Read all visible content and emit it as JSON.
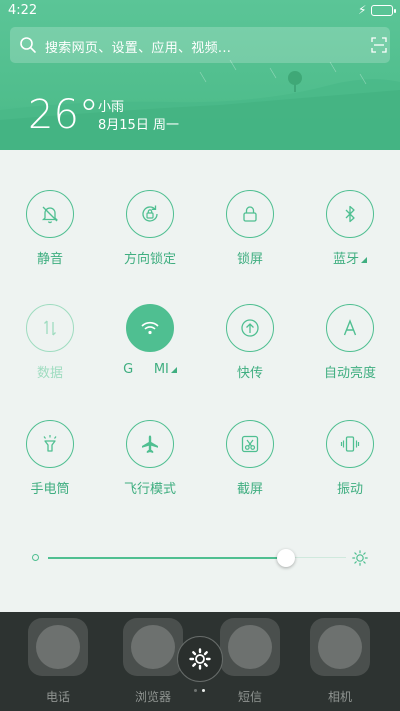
{
  "status_bar": {
    "time": "4:22"
  },
  "search": {
    "placeholder": "搜索网页、设置、应用、视频..."
  },
  "weather": {
    "temperature": "26°",
    "description": "小雨",
    "date": "8月15日 周一"
  },
  "toggles": [
    {
      "label": "静音",
      "icon": "bell-mute-icon",
      "state": "off"
    },
    {
      "label": "方向锁定",
      "icon": "rotation-lock-icon",
      "state": "off"
    },
    {
      "label": "锁屏",
      "icon": "lock-icon",
      "state": "off"
    },
    {
      "label": "蓝牙",
      "icon": "bluetooth-icon",
      "state": "off",
      "has_menu": true
    },
    {
      "label": "数据",
      "icon": "data-arrows-icon",
      "state": "disabled"
    },
    {
      "label": "G     MI",
      "icon": "wifi-icon",
      "state": "on",
      "has_menu": true
    },
    {
      "label": "快传",
      "icon": "quick-transfer-icon",
      "state": "off"
    },
    {
      "label": "自动亮度",
      "icon": "auto-brightness-icon",
      "state": "off"
    },
    {
      "label": "手电筒",
      "icon": "flashlight-icon",
      "state": "off"
    },
    {
      "label": "飞行模式",
      "icon": "airplane-icon",
      "state": "off"
    },
    {
      "label": "截屏",
      "icon": "screenshot-icon",
      "state": "off"
    },
    {
      "label": "振动",
      "icon": "vibrate-icon",
      "state": "off"
    }
  ],
  "brightness": {
    "level": 0.8
  },
  "dock": {
    "apps": [
      {
        "label": "电话",
        "icon": "phone-app-icon"
      },
      {
        "label": "浏览器",
        "icon": "browser-app-icon"
      },
      {
        "label": "短信",
        "icon": "messages-app-icon"
      },
      {
        "label": "相机",
        "icon": "camera-app-icon"
      }
    ],
    "page_indicator": {
      "current": 2,
      "total": 2
    }
  },
  "colors": {
    "accent": "#4fbf91",
    "header": "#54c293",
    "panel": "#eef3f1",
    "dock": "#2d3331"
  }
}
